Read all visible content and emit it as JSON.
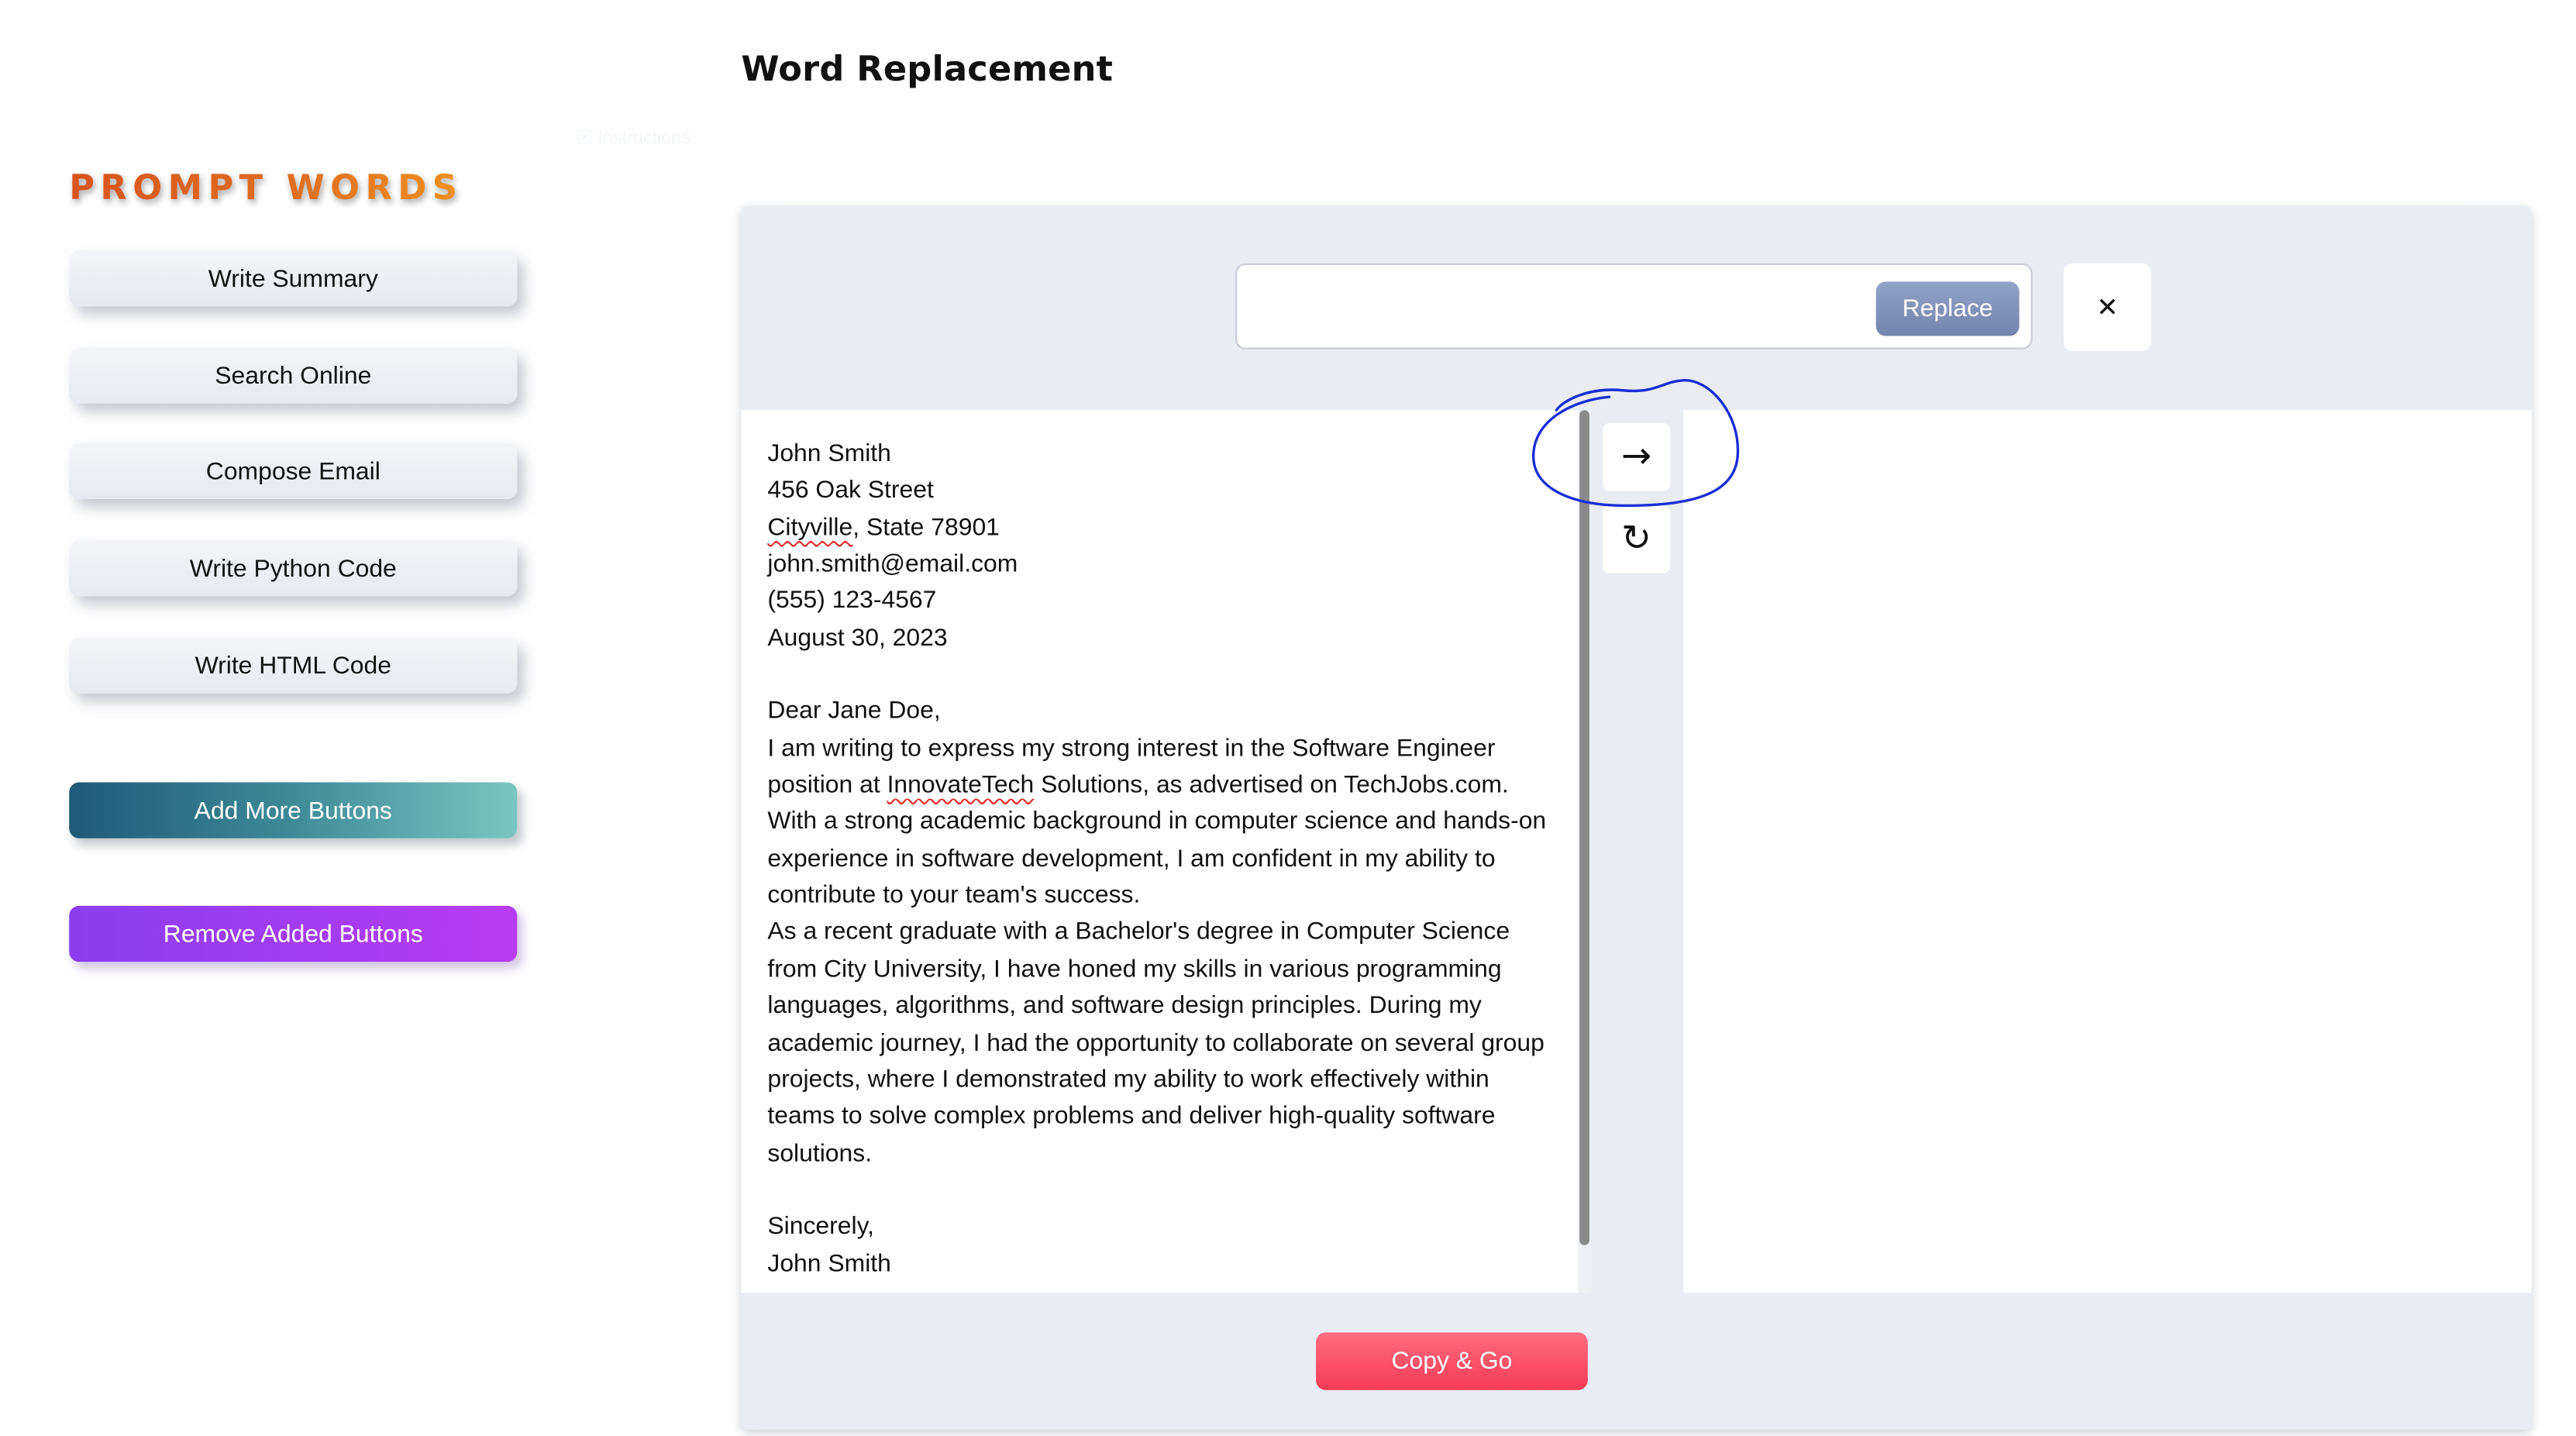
{
  "page": {
    "title": "Word Replacement",
    "faint_label": "☒ Instructions"
  },
  "sidebar": {
    "heading": "PROMPT WORDS",
    "buttons": [
      {
        "label": "Write Summary"
      },
      {
        "label": "Search Online"
      },
      {
        "label": "Compose Email"
      },
      {
        "label": "Write Python Code"
      },
      {
        "label": "Write HTML Code"
      }
    ],
    "add_button_label": "Add More Buttons",
    "remove_button_label": "Remove Added Buttons"
  },
  "replace_bar": {
    "input_value": "",
    "input_placeholder": "",
    "replace_label": "Replace",
    "close_label": "✕"
  },
  "tools": {
    "arrow_glyph": "→",
    "refresh_glyph": "↻"
  },
  "letter": {
    "lines": [
      "John Smith",
      "456 Oak Street",
      "Cityville, State 78901",
      "john.smith@email.com",
      "(555) 123-4567",
      "August 30, 2023",
      "",
      "Dear Jane Doe,",
      "I am writing to express my strong interest in the Software Engineer",
      "position at InnovateTech Solutions, as advertised on TechJobs.com.",
      "With a strong academic background in computer science and hands-on",
      "experience in software development, I am confident in my ability to",
      "contribute to your team's success.",
      "As a recent graduate with a Bachelor's degree in Computer Science",
      "from City University, I have honed my skills in various programming",
      "languages, algorithms, and software design principles. During my",
      "academic journey, I had the opportunity to collaborate on several group",
      "projects, where I demonstrated my ability to work effectively within",
      "teams to solve complex problems and deliver high-quality software",
      "solutions.",
      "",
      "Sincerely,",
      "John Smith"
    ],
    "misspelled": [
      "Cityville",
      "InnovateTech"
    ]
  },
  "output": {
    "text": ""
  },
  "footer": {
    "copy_label": "Copy & Go"
  },
  "colors": {
    "accent_replace": "#7d8fb8",
    "accent_copy": "#f84a63",
    "add_gradient": [
      "#1f5a78",
      "#7ac6c0"
    ],
    "remove_gradient": [
      "#8a3ef0",
      "#b83df2"
    ],
    "heading": "#d9531e",
    "annotation": "#1a2ed6"
  }
}
